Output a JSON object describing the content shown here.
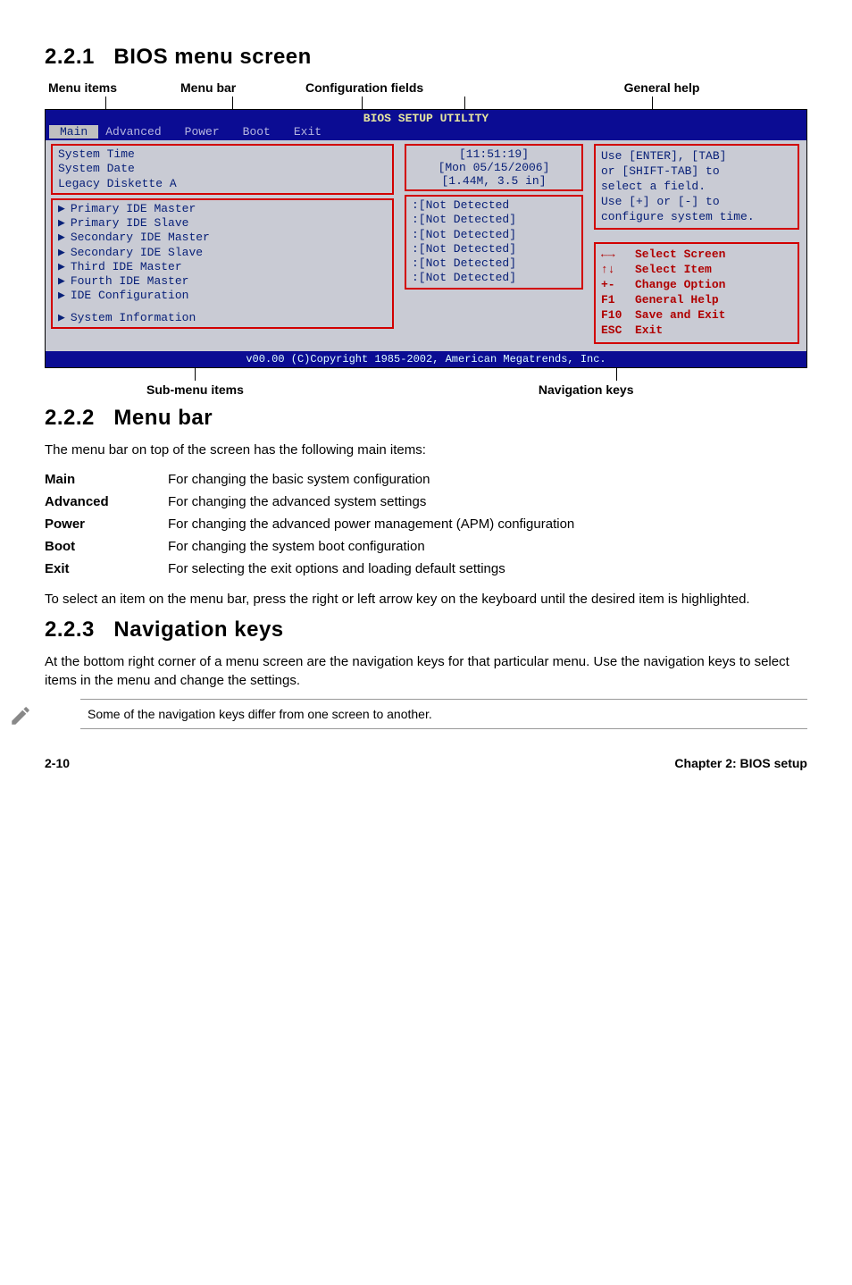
{
  "sections": {
    "s1": {
      "num": "2.2.1",
      "title": "BIOS menu screen"
    },
    "s2": {
      "num": "2.2.2",
      "title": "Menu bar"
    },
    "s3": {
      "num": "2.2.3",
      "title": "Navigation keys"
    }
  },
  "diagram": {
    "topLabels": {
      "menuItems": "Menu items",
      "menuBar": "Menu bar",
      "configFields": "Configuration fields",
      "generalHelp": "General help"
    },
    "bios": {
      "title": "BIOS SETUP UTILITY",
      "menubar": {
        "main": "Main",
        "advanced": "Advanced",
        "power": "Power",
        "boot": "Boot",
        "exit": "Exit"
      },
      "left": {
        "l1": "System Time",
        "l2": "System Date",
        "l3": "Legacy Diskette A",
        "l4": "Primary IDE Master",
        "l5": "Primary IDE Slave",
        "l6": "Secondary IDE Master",
        "l7": "Secondary IDE Slave",
        "l8": "Third IDE Master",
        "l9": "Fourth IDE Master",
        "l10": "IDE Configuration",
        "l11": "System Information"
      },
      "mid": {
        "m1": "[11:51:19]",
        "m2": "[Mon 05/15/2006]",
        "m3": "[1.44M, 3.5 in]",
        "m4": ":[Not Detected",
        "m5": ":[Not Detected]",
        "m6": ":[Not Detected]",
        "m7": ":[Not Detected]",
        "m8": ":[Not Detected]",
        "m9": ":[Not Detected]"
      },
      "help": {
        "h1": "Use [ENTER], [TAB]",
        "h2": "or [SHIFT-TAB] to",
        "h3": "select a field.",
        "h4": "Use [+] or [-] to",
        "h5": "configure system time."
      },
      "nav": {
        "k1": "←→",
        "d1": "Select Screen",
        "k2": "↑↓",
        "d2": "Select Item",
        "k3": "+-",
        "d3": "Change Option",
        "k4": "F1",
        "d4": "General Help",
        "k5": "F10",
        "d5": "Save and Exit",
        "k6": "ESC",
        "d6": "Exit"
      },
      "footer": "v00.00 (C)Copyright 1985-2002, American Megatrends, Inc."
    },
    "bottomLabels": {
      "submenu": "Sub-menu items",
      "navkeys": "Navigation keys"
    }
  },
  "menubar_section": {
    "intro": "The menu bar on top of the screen has the following main items:",
    "items": {
      "main": {
        "term": "Main",
        "desc": "For changing the basic system configuration"
      },
      "advanced": {
        "term": "Advanced",
        "desc": "For changing the advanced system settings"
      },
      "power": {
        "term": "Power",
        "desc": "For changing the advanced power management (APM) configuration"
      },
      "boot": {
        "term": "Boot",
        "desc": "For changing the system boot configuration"
      },
      "exit": {
        "term": "Exit",
        "desc": "For selecting the exit options and loading default settings"
      }
    },
    "outro": "To select an item on the menu bar, press the right or left arrow key on the keyboard until the desired item is highlighted."
  },
  "navkeys_section": {
    "text": "At the bottom right corner of a menu screen are the navigation keys for that particular menu. Use the navigation keys to select items in the menu and change the settings.",
    "note": "Some of the navigation keys differ from one screen to another."
  },
  "footer": {
    "page": "2-10",
    "chapter": "Chapter 2: BIOS setup"
  }
}
